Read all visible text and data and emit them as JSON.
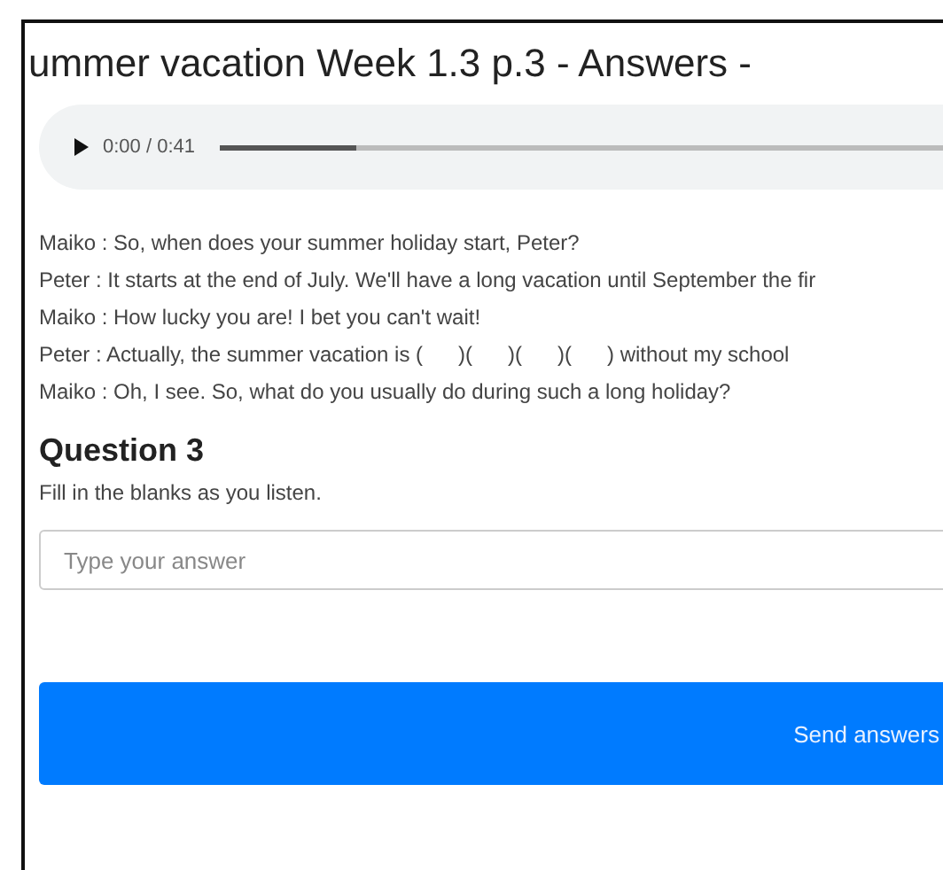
{
  "title": "ummer vacation Week 1.3 p.3 - Answers -",
  "audio": {
    "time": "0:00 / 0:41",
    "level": 0.18
  },
  "dialogue": [
    "Maiko : So, when does your summer holiday start, Peter?",
    "Peter : It starts at the end of July. We'll have a long vacation until September the fir",
    "Maiko : How lucky you are! I bet you can't wait!",
    "Peter : Actually, the summer vacation is (      )(      )(      )(      ) without my school",
    "Maiko : Oh, I see. So, what do you usually do during such a long holiday?"
  ],
  "question": {
    "heading": "Question 3",
    "instruction": "Fill in the blanks as you listen.",
    "placeholder": "Type your answer"
  },
  "submit": "Send answers"
}
